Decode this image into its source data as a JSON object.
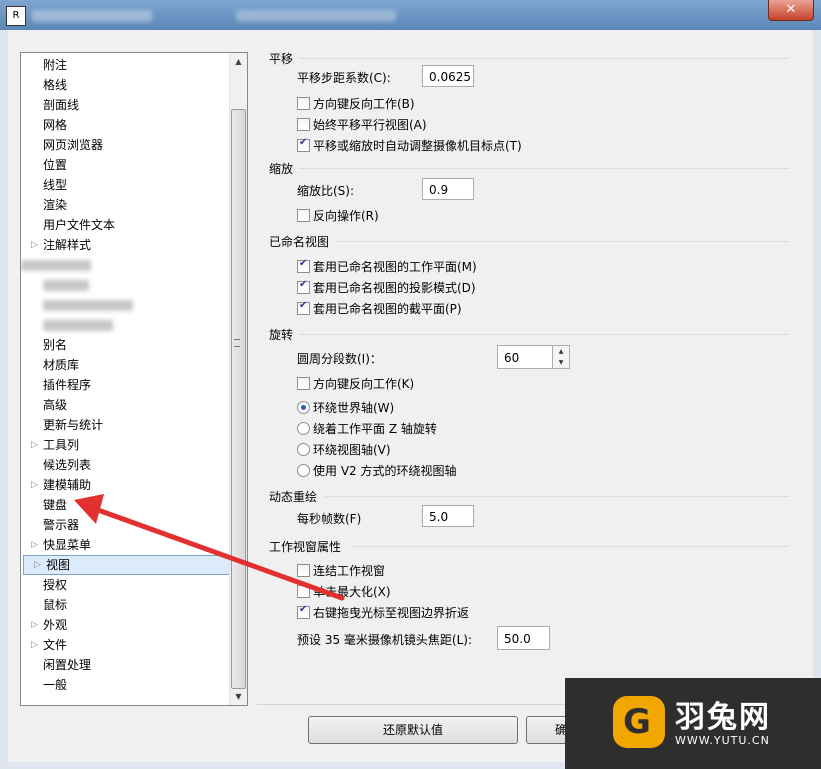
{
  "window": {
    "close_label": "✕"
  },
  "sidebar": {
    "items": [
      {
        "label": "附注",
        "expander": ""
      },
      {
        "label": "格线",
        "expander": ""
      },
      {
        "label": "剖面线",
        "expander": ""
      },
      {
        "label": "网格",
        "expander": ""
      },
      {
        "label": "网页浏览器",
        "expander": ""
      },
      {
        "label": "位置",
        "expander": ""
      },
      {
        "label": "线型",
        "expander": ""
      },
      {
        "label": "渲染",
        "expander": ""
      },
      {
        "label": "用户文件文本",
        "expander": ""
      },
      {
        "label": "注解样式",
        "expander": "▷"
      },
      {
        "label": "",
        "expander": ""
      },
      {
        "label": "",
        "expander": ""
      },
      {
        "label": "",
        "expander": ""
      },
      {
        "label": "",
        "expander": ""
      },
      {
        "label": "别名",
        "expander": ""
      },
      {
        "label": "材质库",
        "expander": ""
      },
      {
        "label": "插件程序",
        "expander": ""
      },
      {
        "label": "高级",
        "expander": ""
      },
      {
        "label": "更新与统计",
        "expander": ""
      },
      {
        "label": "工具列",
        "expander": "▷"
      },
      {
        "label": "候选列表",
        "expander": ""
      },
      {
        "label": "建模辅助",
        "expander": "▷"
      },
      {
        "label": "键盘",
        "expander": ""
      },
      {
        "label": "警示器",
        "expander": ""
      },
      {
        "label": "快显菜单",
        "expander": "▷"
      },
      {
        "label": "视图",
        "expander": "▷"
      },
      {
        "label": "授权",
        "expander": ""
      },
      {
        "label": "鼠标",
        "expander": ""
      },
      {
        "label": "外观",
        "expander": "▷"
      },
      {
        "label": "文件",
        "expander": "▷"
      },
      {
        "label": "闲置处理",
        "expander": ""
      },
      {
        "label": "一般",
        "expander": ""
      }
    ],
    "selected_index": 25
  },
  "pan": {
    "title": "平移",
    "step_label": "平移步距系数(C):",
    "step_value": "0.0625",
    "reverse_label": "方向键反向工作(B)",
    "reverse_checked": false,
    "parallel_label": "始终平移平行视图(A)",
    "parallel_checked": false,
    "adjust_label": "平移或缩放时自动调整摄像机目标点(T)",
    "adjust_checked": true
  },
  "zoom": {
    "title": "缩放",
    "ratio_label": "缩放比(S):",
    "ratio_value": "0.9",
    "reverse_label": "反向操作(R)",
    "reverse_checked": false
  },
  "named_views": {
    "title": "已命名视图",
    "cplane_label": "套用已命名视图的工作平面(M)",
    "cplane_checked": true,
    "projection_label": "套用已命名视图的投影模式(D)",
    "projection_checked": true,
    "clipping_label": "套用已命名视图的截平面(P)",
    "clipping_checked": true
  },
  "rotate": {
    "title": "旋转",
    "segments_label": "圆周分段数(I)：",
    "segments_value": "60",
    "reverse_label": "方向键反向工作(K)",
    "reverse_checked": false,
    "world_label": "环绕世界轴(W)",
    "cplane_z_label": "绕着工作平面 Z 轴旋转",
    "view_label": "环绕视图轴(V)",
    "v2_label": "使用 V2 方式的环绕视图轴",
    "selected_option": "world"
  },
  "redraw": {
    "title": "动态重绘",
    "fps_label": "每秒帧数(F)",
    "fps_value": "5.0"
  },
  "viewport": {
    "title": "工作视窗属性",
    "link_label": "连结工作视窗",
    "link_checked": false,
    "maximize_label": "单击最大化(X)",
    "maximize_checked": false,
    "wrap_label": "右键拖曳光标至视图边界折返",
    "wrap_checked": true,
    "focal_label": "预设 35 毫米摄像机镜头焦距(L):",
    "focal_value": "50.0"
  },
  "buttons": {
    "restore_label": "还原默认值",
    "ok_label": "确"
  },
  "watermark": {
    "name": "羽兔网",
    "url": "WWW.YUTU.CN"
  },
  "colors": {
    "arrow": "#e23030",
    "accent": "#2b5eb5",
    "watermark_bg": "#2e2e2e",
    "watermark_logo": "#f2a700"
  }
}
